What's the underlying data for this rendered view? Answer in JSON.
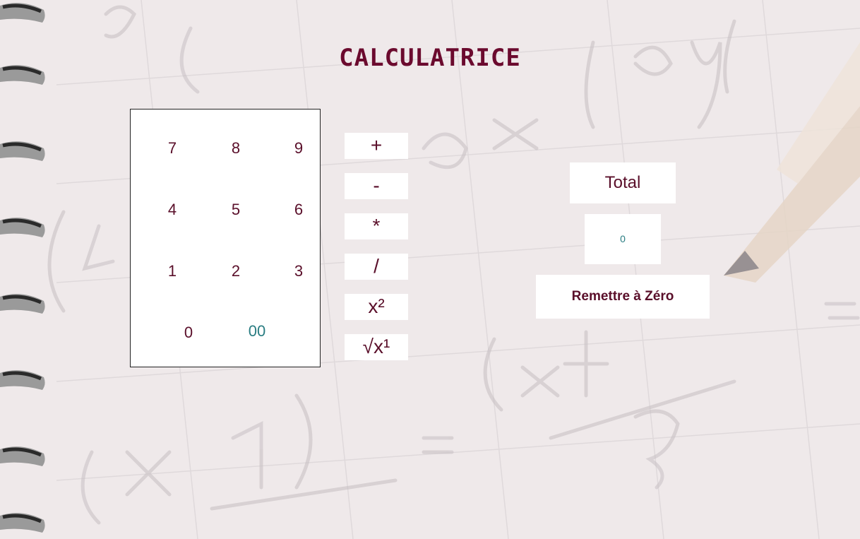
{
  "app": {
    "title": "CALCULATRICE"
  },
  "keypad": {
    "keys": [
      "7",
      "8",
      "9",
      "4",
      "5",
      "6",
      "1",
      "2",
      "3",
      "0",
      "00"
    ]
  },
  "operators": [
    "+",
    "-",
    "*",
    "/",
    "x²",
    "√x¹"
  ],
  "result": {
    "label": "Total",
    "value": "0"
  },
  "reset_label": "Remettre à Zéro",
  "colors": {
    "title": "#6b0a2e",
    "digit": "#5a0f2a",
    "accent_teal": "#2a7d82"
  },
  "background": {
    "ring_icon": "spiral-binding-ring-icon",
    "texture_icon": "math-notebook-background-icon"
  }
}
